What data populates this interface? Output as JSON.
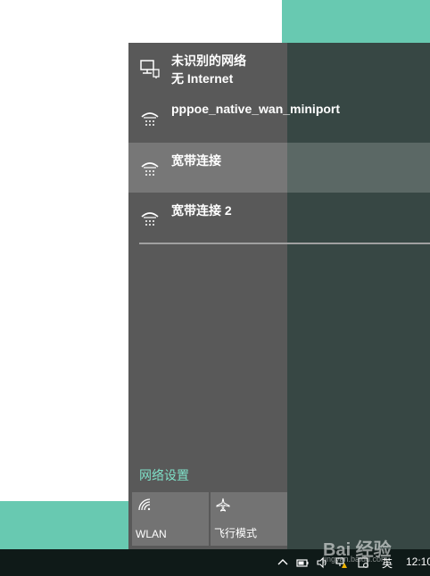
{
  "networks": [
    {
      "name": "未识别的网络",
      "status": "无 Internet",
      "icon": "ethernet-icon",
      "selected": false
    },
    {
      "name": "pppoe_native_wan_miniport",
      "status": "",
      "icon": "dialup-icon",
      "selected": false
    },
    {
      "name": "宽带连接",
      "status": "",
      "icon": "dialup-icon",
      "selected": true
    },
    {
      "name": "宽带连接 2",
      "status": "",
      "icon": "dialup-icon",
      "selected": false
    }
  ],
  "settings_link": "网络设置",
  "tiles": {
    "wlan": {
      "label": "WLAN",
      "icon": "wifi-icon"
    },
    "airplane": {
      "label": "飞行模式",
      "icon": "airplane-icon"
    }
  },
  "taskbar": {
    "ime": "英",
    "clock": "12:10"
  },
  "watermark": {
    "text": "Bai 经验",
    "sub": "jingyan.baidu.com"
  },
  "colors": {
    "accent_link": "#7fe0c8",
    "desktop_teal": "#68c9b1",
    "flyout_bg": "#595959"
  }
}
